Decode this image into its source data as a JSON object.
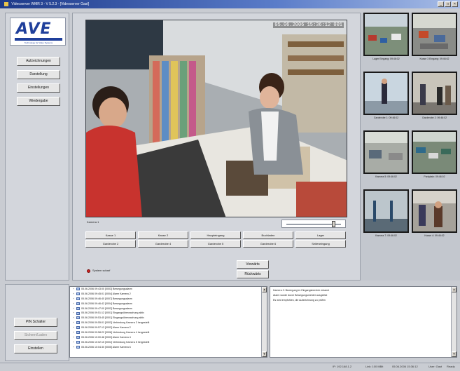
{
  "window": {
    "title": "Videoserver WMR 3 - V 5.2.3 - [Videoserver Gast]",
    "min": "_",
    "max": "□",
    "close": "×"
  },
  "logo": {
    "text": "AVE",
    "subtext": "Technology for Video Systems"
  },
  "left_menu": [
    "Aufzeichnungen",
    "Darstellung",
    "Einstellungen",
    "Wiedergabe"
  ],
  "video": {
    "timestamp": "05.06.2006  15:36:12  001",
    "camera_name": "Kamera 1",
    "position_percent": 82
  },
  "controls": {
    "row1": [
      "Kasse 1",
      "Kasse 2",
      "Haupteingang",
      "Buchladen",
      "Lager"
    ],
    "row2": [
      "Garderobe 2",
      "Garderobe 4",
      "Garderobe 5",
      "Garderobe 6",
      "Seiteneingang"
    ]
  },
  "side_buttons": [
    "Vorwärts",
    "Rückwärts"
  ],
  "status": {
    "label": "System scharf",
    "color": "#d0211f"
  },
  "thumbnails": [
    {
      "label": "Lager Eingang: 09:46:02"
    },
    {
      "label": "Kasse 3 Eingang: 09:46:02"
    },
    {
      "label": "Garderobe 1: 09:46:02"
    },
    {
      "label": "Garderobe 2: 09:46:02"
    },
    {
      "label": "Kamera 5: 09:46:02"
    },
    {
      "label": "Parkplatz: 09:46:02"
    },
    {
      "label": "Kamera 7: 09:46:02"
    },
    {
      "label": "Kasse 4: 09:46:02"
    }
  ],
  "bottom_left": {
    "buttons": [
      "PIN Schalter",
      "Sichern/Laden",
      "Einstellen"
    ],
    "disabled_index": 1
  },
  "log_entries": [
    "05.06.2006 09:43:00 [0003] Bewegungsalarm",
    "05.06.2006 09:45:01 [0004] Alarm Kamera 2",
    "05.06.2006 09:46:40 [0007] Bewegungsalarm",
    "05.06.2006 09:46:42 [0004] Bewegungsalarm",
    "05.06.2006 09:47:00 [0002] Bewegungsalarm",
    "05.06.2006 09:51:12 [0001] Eingangsüberwachung aktiv",
    "05.06.2006 09:53:45 [0001] Eingangsüberwachung aktiv",
    "05.06.2006 09:55:01 [0003] Verbindung Kamera 3 hergestellt",
    "05.06.2006 09:57:13 [0002] Alarm Kamera 2",
    "05.06.2006 09:58:22 [0006] Verbindung Kamera 4 hergestellt",
    "05.06.2006 10:00:48 [0003] Alarm Kamera 4",
    "05.06.2006 10:02:15 [0004] Verbindung Kamera 5 hergestellt",
    "05.06.2006 10:04:30 [0005] Alarm Kamera 6"
  ],
  "log_text": [
    "Kamera 2: Bewegung im Eingangsbereich erkannt",
    "Alarm wurde durch Bewegungsmelder ausgelöst",
    "Es wird empfohlen, die Aufzeichnung zu prüfen"
  ],
  "statusbar": {
    "left": "",
    "right": [
      "IP: 192.168.1.2",
      "Link: 100 MBit",
      "05.06.2006 15:36:12",
      "User: Gast",
      "Ready"
    ]
  }
}
